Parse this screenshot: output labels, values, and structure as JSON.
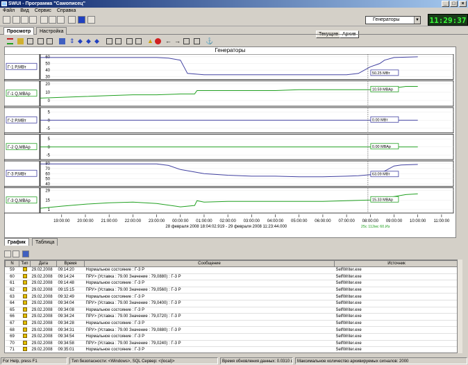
{
  "window": {
    "title": "SWUI - Программа \"Самописец\""
  },
  "menu": [
    "Файл",
    "Вид",
    "Сервис",
    "Справка"
  ],
  "mode_buttons": {
    "current": "Текущие",
    "archive": "Архив"
  },
  "combo": {
    "value": "Генераторы"
  },
  "clock": "11:29:37",
  "tabs": [
    "Просмотр",
    "Настройка"
  ],
  "chart": {
    "title": "Генераторы",
    "time_labels": [
      "19:00:00",
      "20:00:00",
      "21:00:00",
      "22:00:00",
      "23:00:00",
      "00:00:00",
      "01:00:00",
      "02:00:00",
      "03:00:00",
      "04:00:00",
      "05:00:00",
      "06:00:00",
      "07:00:00",
      "08:00:00",
      "09:00:00",
      "10:00:00",
      "11:00:00"
    ],
    "range_text": "28 февраля 2008 18:04:02.919 - 29 февраля 2008 11:23:44.000",
    "cursor_label": "25с 112мс 60.Из"
  },
  "chart_data": [
    {
      "type": "line",
      "label": "Г-1 P,МВт",
      "ticks": [
        "60",
        "50",
        "40",
        "30"
      ],
      "ylim": [
        28,
        62
      ],
      "color": "#4040a0",
      "value_label": "50.25 МВт",
      "x": [
        18.1,
        19,
        20,
        21,
        22,
        23,
        23.5,
        24,
        24.3,
        25,
        26,
        27,
        28,
        29,
        30,
        31,
        31.5,
        32,
        32.4,
        32.6,
        33,
        34
      ],
      "values": [
        59,
        59,
        59,
        59,
        59,
        59,
        58,
        55,
        35,
        33,
        33,
        33,
        33,
        33,
        33,
        33,
        35,
        45,
        50,
        55,
        59,
        60
      ]
    },
    {
      "type": "line",
      "label": "Г-1 Q,МВАр",
      "ticks": [
        "20",
        "10",
        "0"
      ],
      "ylim": [
        -5,
        22
      ],
      "color": "#20a020",
      "value_label": "10.59 МВАр",
      "x": [
        18.1,
        19,
        20,
        21,
        22,
        23,
        24,
        24.6,
        24.7,
        25,
        26,
        27,
        28,
        29,
        30,
        31,
        32,
        32.5,
        33,
        33.5,
        34
      ],
      "values": [
        3,
        4,
        5,
        6,
        7,
        7,
        8,
        8,
        12,
        12,
        12,
        12,
        12,
        13,
        13,
        13,
        13,
        11,
        15,
        17,
        17
      ]
    },
    {
      "type": "line",
      "label": "Г-2 P,МВт",
      "ticks": [
        "5",
        "0",
        "-5"
      ],
      "ylim": [
        -7,
        7
      ],
      "color": "#4040a0",
      "value_label": "0.00 МВт",
      "x": [
        18.1,
        34
      ],
      "values": [
        0,
        0
      ]
    },
    {
      "type": "line",
      "label": "Г-2 Q,МВАр",
      "ticks": [
        "5",
        "0",
        "-5"
      ],
      "ylim": [
        -7,
        7
      ],
      "color": "#20a020",
      "value_label": "0.00 МВАр",
      "x": [
        18.1,
        34
      ],
      "values": [
        0,
        0
      ]
    },
    {
      "type": "line",
      "label": "Г-3 P,МВт",
      "ticks": [
        "80",
        "70",
        "60",
        "50",
        "40"
      ],
      "ylim": [
        38,
        82
      ],
      "color": "#4040a0",
      "value_label": "63.09 МВт",
      "x": [
        18.1,
        19,
        20,
        21,
        22,
        23,
        23.5,
        24,
        25,
        26,
        27,
        28,
        29,
        30,
        31,
        31.5,
        32,
        32.4,
        33,
        33.3,
        34
      ],
      "values": [
        79,
        79,
        79,
        79,
        79,
        79,
        76,
        68,
        60,
        57,
        55,
        55,
        54,
        54,
        55,
        56,
        58,
        60,
        75,
        77,
        78
      ]
    },
    {
      "type": "line",
      "label": "Г-3 Q,МВАр",
      "ticks": [
        "29",
        "15",
        "1"
      ],
      "ylim": [
        -2,
        31
      ],
      "color": "#20a020",
      "value_label": "15.33 МВАр",
      "x": [
        18.1,
        19,
        20,
        21,
        22,
        23,
        24,
        24.6,
        24.7,
        25,
        26,
        27,
        28,
        29,
        30,
        31,
        32,
        32.5,
        33,
        33.5,
        34
      ],
      "values": [
        3,
        6,
        9,
        11,
        12,
        10,
        5,
        7,
        14,
        12,
        13,
        13,
        13,
        13,
        13,
        14,
        15,
        17,
        20,
        23,
        24
      ]
    }
  ],
  "bottom_tabs": [
    "График",
    "Таблица"
  ],
  "table": {
    "headers": [
      "N",
      "Тип",
      "Дата",
      "Время",
      "Сообщение",
      "Источник"
    ],
    "rows": [
      [
        "59",
        "29.02.2008",
        "09:14:20",
        "Нормальное состояние : Г-3 P",
        "SelfWriter.exe"
      ],
      [
        "60",
        "29.02.2008",
        "09:14:24",
        "ПРУ> (Уставка : 79.00 Значение : 79,0880) : Г-3 P",
        "SelfWriter.exe"
      ],
      [
        "61",
        "29.02.2008",
        "09:14:48",
        "Нормальное состояние : Г-3 P",
        "SelfWriter.exe"
      ],
      [
        "62",
        "29.02.2008",
        "09:15:15",
        "ПРУ> (Уставка : 79.00 Значение : 79,0560) : Г-3 P",
        "SelfWriter.exe"
      ],
      [
        "63",
        "29.02.2008",
        "09:32:49",
        "Нормальное состояние : Г-3 P",
        "SelfWriter.exe"
      ],
      [
        "64",
        "29.02.2008",
        "09:34:04",
        "ПРУ> (Уставка : 79.00 Значение : 79,0400) : Г-3 P",
        "SelfWriter.exe"
      ],
      [
        "65",
        "29.02.2008",
        "09:34:08",
        "Нормальное состояние : Г-3 P",
        "SelfWriter.exe"
      ],
      [
        "66",
        "29.02.2008",
        "09:34:24",
        "ПРУ> (Уставка : 79.00 Значение : 79,0720) : Г-3 P",
        "SelfWriter.exe"
      ],
      [
        "67",
        "29.02.2008",
        "09:34:28",
        "Нормальное состояние : Г-3 P",
        "SelfWriter.exe"
      ],
      [
        "68",
        "29.02.2008",
        "09:34:31",
        "ПРУ> (Уставка : 79.00 Значение : 79,0880) : Г-3 P",
        "SelfWriter.exe"
      ],
      [
        "69",
        "29.02.2008",
        "09:34:54",
        "Нормальное состояние : Г-3 P",
        "SelfWriter.exe"
      ],
      [
        "70",
        "29.02.2008",
        "09:34:58",
        "ПРУ> (Уставка : 79.00 Значение : 79,0240) : Г-3 P",
        "SelfWriter.exe"
      ],
      [
        "71",
        "29.02.2008",
        "09:35:01",
        "Нормальное состояние : Г-3 P",
        "SelfWriter.exe"
      ]
    ]
  },
  "status": {
    "help": "For Help, press F1",
    "security": "Тип безопасности: <Windows>, SQL Сервер: <(local)>",
    "refresh": "Время обновления данных: 0.0310 с",
    "max": "Максимальное количество архивируемых сигналов: 2000"
  }
}
